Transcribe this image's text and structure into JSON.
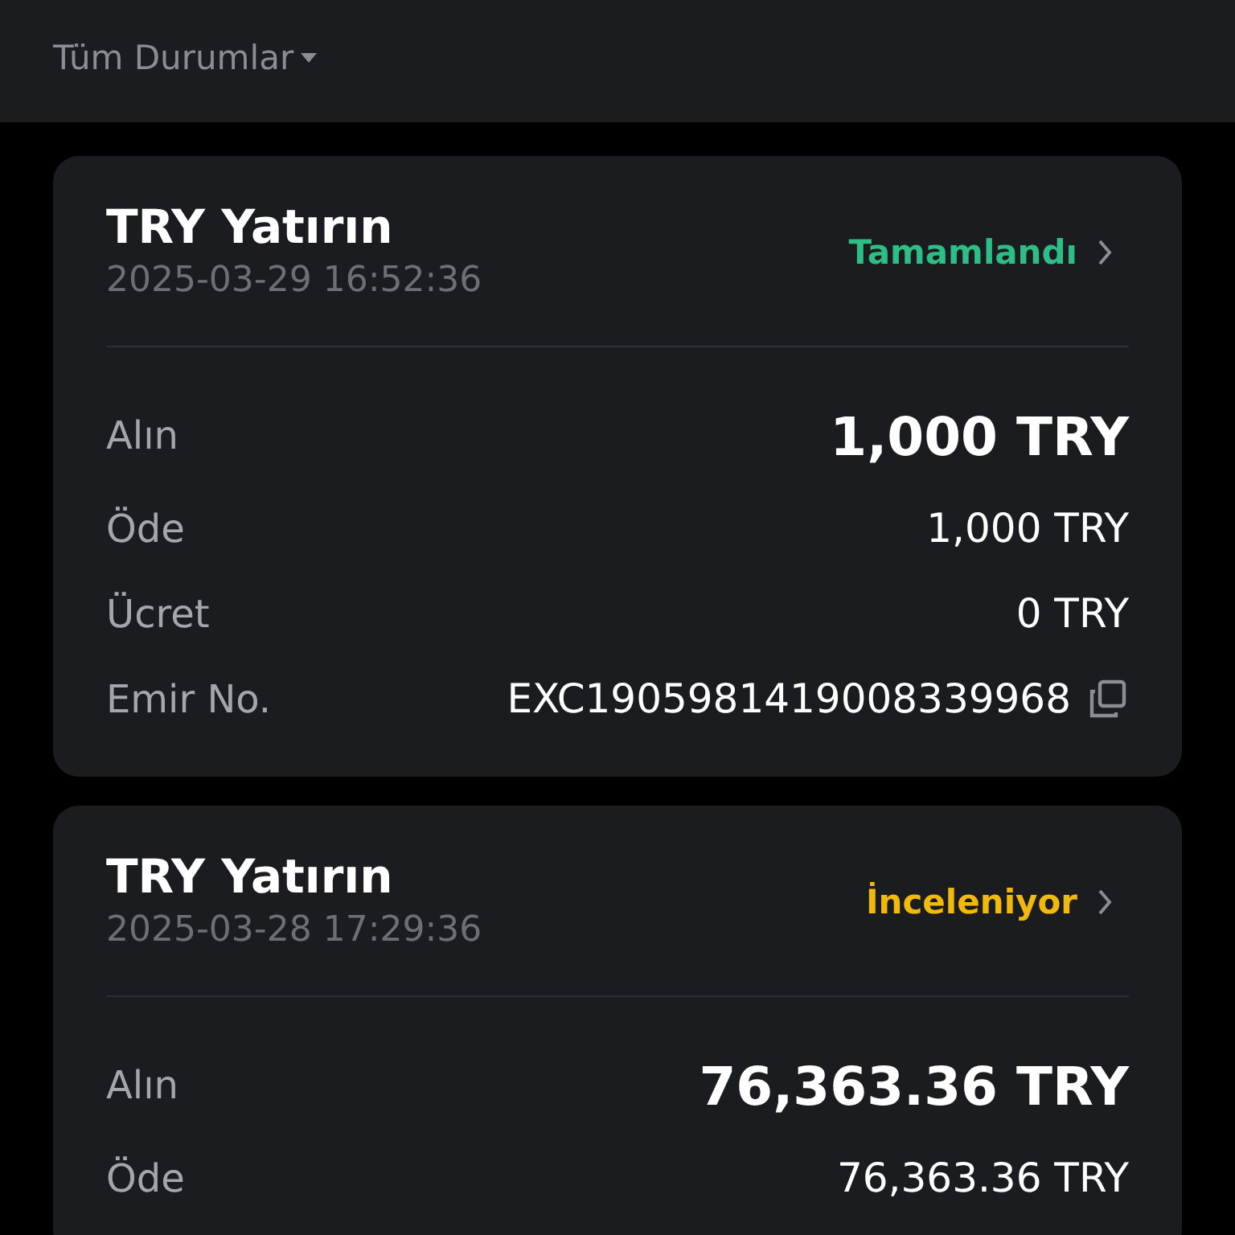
{
  "filter": {
    "label": "Tüm Durumlar"
  },
  "orders": [
    {
      "title": "TRY Yatırın",
      "date": "2025-03-29 16:52:36",
      "status": "Tamamlandı",
      "color": "#2ebd85",
      "rows": [
        {
          "kind": "large",
          "label": "Alın",
          "value": "1,000 TRY"
        },
        {
          "kind": "plain",
          "label": "Öde",
          "value": "1,000 TRY"
        },
        {
          "kind": "plain",
          "label": "Ücret",
          "value": "0 TRY"
        },
        {
          "kind": "copy",
          "label": "Emir No.",
          "value": "EXC1905981419008339968"
        }
      ]
    },
    {
      "title": "TRY Yatırın",
      "date": "2025-03-28 17:29:36",
      "status": "İnceleniyor",
      "color": "#f0b90b",
      "rows": [
        {
          "kind": "large",
          "label": "Alın",
          "value": "76,363.36 TRY"
        },
        {
          "kind": "plain",
          "label": "Öde",
          "value": "76,363.36 TRY"
        }
      ]
    }
  ]
}
